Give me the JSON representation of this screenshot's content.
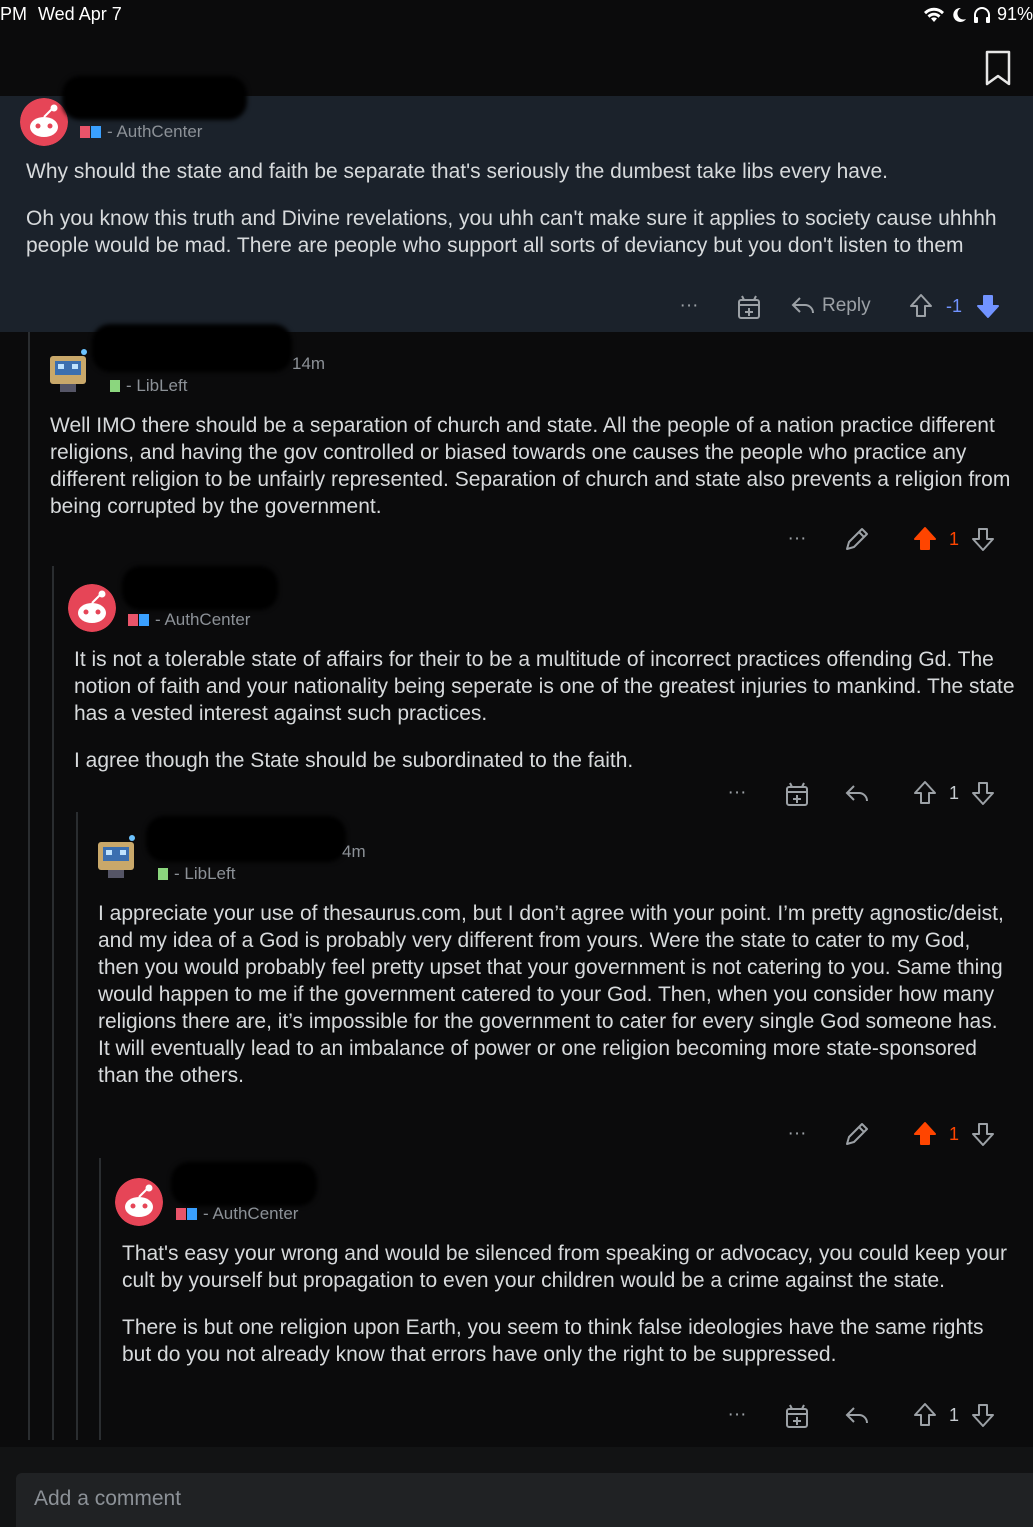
{
  "status": {
    "time": "PM",
    "date": "Wed Apr 7",
    "battery": "91%",
    "icons": [
      "wifi-icon",
      "moon-icon",
      "headphones-icon"
    ]
  },
  "comments": [
    {
      "flair": "- AuthCenter",
      "avatar": "snoo-red",
      "paragraphs": [
        "Why should the state and faith be separate that's seriously the dumbest take libs every have.",
        "Oh you know this truth and Divine revelations, you uhh can't make sure it applies to society cause uhhhh people would be mad. There are people who support all sorts of deviancy but you don't listen to them"
      ],
      "reply_label": "Reply",
      "score": "-1",
      "vote": "down"
    },
    {
      "age": "14m",
      "flair": "- LibLeft",
      "avatar": "robot",
      "paragraphs": [
        "Well IMO there should be a separation of church and state. All the people of a nation practice different religions, and having the gov controlled or biased towards one causes the people who practice any different religion to be unfairly represented. Separation of church and state also prevents a religion from being corrupted by the government."
      ],
      "score": "1",
      "vote": "up"
    },
    {
      "flair": "- AuthCenter",
      "avatar": "snoo-red",
      "paragraphs": [
        "It is not a tolerable state of affairs for their to be a multitude of incorrect practices offending Gd. The notion of faith and your nationality being seperate is one of the greatest injuries to mankind. The state has a vested interest against such practices.",
        "I agree though the State should be subordinated to the faith."
      ],
      "score": "1",
      "vote": "none"
    },
    {
      "age": "4m",
      "flair": "- LibLeft",
      "avatar": "robot",
      "paragraphs": [
        "I appreciate your use of thesaurus.com, but I don’t agree with your point. I’m pretty agnostic/deist, and my idea of a God is probably very different from yours. Were the state to cater to my God, then you would probably feel pretty upset that your government is not catering to you. Same thing would happen to me if the government catered to your God. Then, when you consider how many religions there are, it’s impossible for the government to cater for every single God someone has. It will eventually lead to an imbalance of power or one religion becoming more state-sponsored than the others."
      ],
      "score": "1",
      "vote": "up"
    },
    {
      "flair": "- AuthCenter",
      "avatar": "snoo-red",
      "paragraphs": [
        "That's easy your wrong and would be silenced from speaking or advocacy, you could keep your cult by yourself but propagation to even your children would be a crime against the state.",
        "There is but one religion upon Earth, you seem to think false ideologies have the same rights but do you not already know that errors have only the right to be suppressed."
      ],
      "score": "1",
      "vote": "none"
    }
  ],
  "composer": {
    "placeholder": "Add a comment"
  },
  "colors": {
    "upvote": "#ff4500",
    "downvote": "#7193ff",
    "auth_red": "#e9546a",
    "auth_blue": "#3aa0ff",
    "libleft_green": "#8bd67e"
  }
}
